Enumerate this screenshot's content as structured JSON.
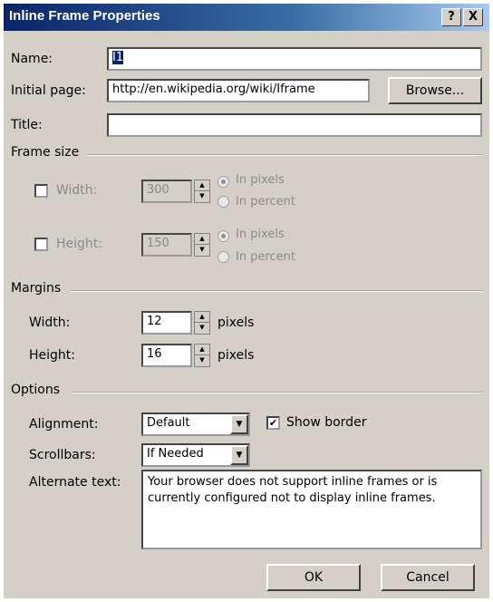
{
  "window": {
    "title": "Inline Frame Properties",
    "help_glyph": "?",
    "close_glyph": "X"
  },
  "fields": {
    "name_label": "Name:",
    "name_value": "I1",
    "initial_page_label": "Initial page:",
    "initial_page_value": "http://en.wikipedia.org/wiki/Iframe",
    "browse_label": "Browse...",
    "title_label": "Title:",
    "title_value": ""
  },
  "frame_size": {
    "group_label": "Frame size",
    "width_label": "Width:",
    "width_value": "300",
    "width_checked": false,
    "width_radio_pixels": "In pixels",
    "width_radio_percent": "In percent",
    "height_label": "Height:",
    "height_value": "150",
    "height_checked": false,
    "height_radio_pixels": "In pixels",
    "height_radio_percent": "In percent"
  },
  "margins": {
    "group_label": "Margins",
    "width_label": "Width:",
    "width_value": "12",
    "width_unit": "pixels",
    "height_label": "Height:",
    "height_value": "16",
    "height_unit": "pixels"
  },
  "options": {
    "group_label": "Options",
    "alignment_label": "Alignment:",
    "alignment_value": "Default",
    "show_border_label": "Show border",
    "show_border_checked": true,
    "scrollbars_label": "Scrollbars:",
    "scrollbars_value": "If Needed",
    "alt_text_label": "Alternate text:",
    "alt_text_value": "Your browser does not support inline frames or is currently configured not to display inline frames."
  },
  "buttons": {
    "ok": "OK",
    "cancel": "Cancel"
  },
  "colors": {
    "titlebar": "#0a246a",
    "dialog_bg": "#d4d0c8",
    "disabled_text": "#8a8a8a"
  }
}
